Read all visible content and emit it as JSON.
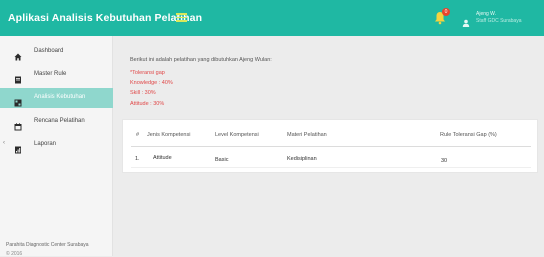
{
  "header": {
    "app_title": "Aplikasi Analisis Kebutuhan Pelatihan",
    "notification_count": "0",
    "user_name": "Ajeng W.",
    "user_role": "Staff GDC Surabaya"
  },
  "colors": {
    "header": "#1fb8a3",
    "sidebar_active": "#8fd7cd",
    "info_text": "#e04848",
    "badge": "#e8452c"
  },
  "sidebar": {
    "items": [
      {
        "label": "Dashboard",
        "icon": "home-icon"
      },
      {
        "label": "Master Rule",
        "icon": "document-icon"
      },
      {
        "label": "Analisis Kebutuhan",
        "icon": "grid-icon",
        "active": true
      },
      {
        "label": "Rencana Pelatihan",
        "icon": "calendar-icon"
      },
      {
        "label": "Laporan",
        "icon": "report-icon"
      }
    ],
    "footer_line1": "Parahita Diagnostic Center Surabaya",
    "footer_line2": "© 2016"
  },
  "content": {
    "intro": "Berikut ini adalah pelatihan yang dibutuhkan Ajeng Wulan:",
    "tolerance_title": "*Toleransi gap",
    "knowledge": "Knowledge : 40%",
    "skill": "Skill : 30%",
    "attitude": "Attitude : 30%"
  },
  "table": {
    "headers": [
      "#",
      "Jenis Kompetensi",
      "Level Kompetensi",
      "Materi Pelatihan",
      "Rule Toleransi Gap (%)"
    ],
    "rows": [
      [
        "1.",
        "Attitude",
        "Basic",
        "Kedisiplinan",
        "30"
      ]
    ]
  }
}
